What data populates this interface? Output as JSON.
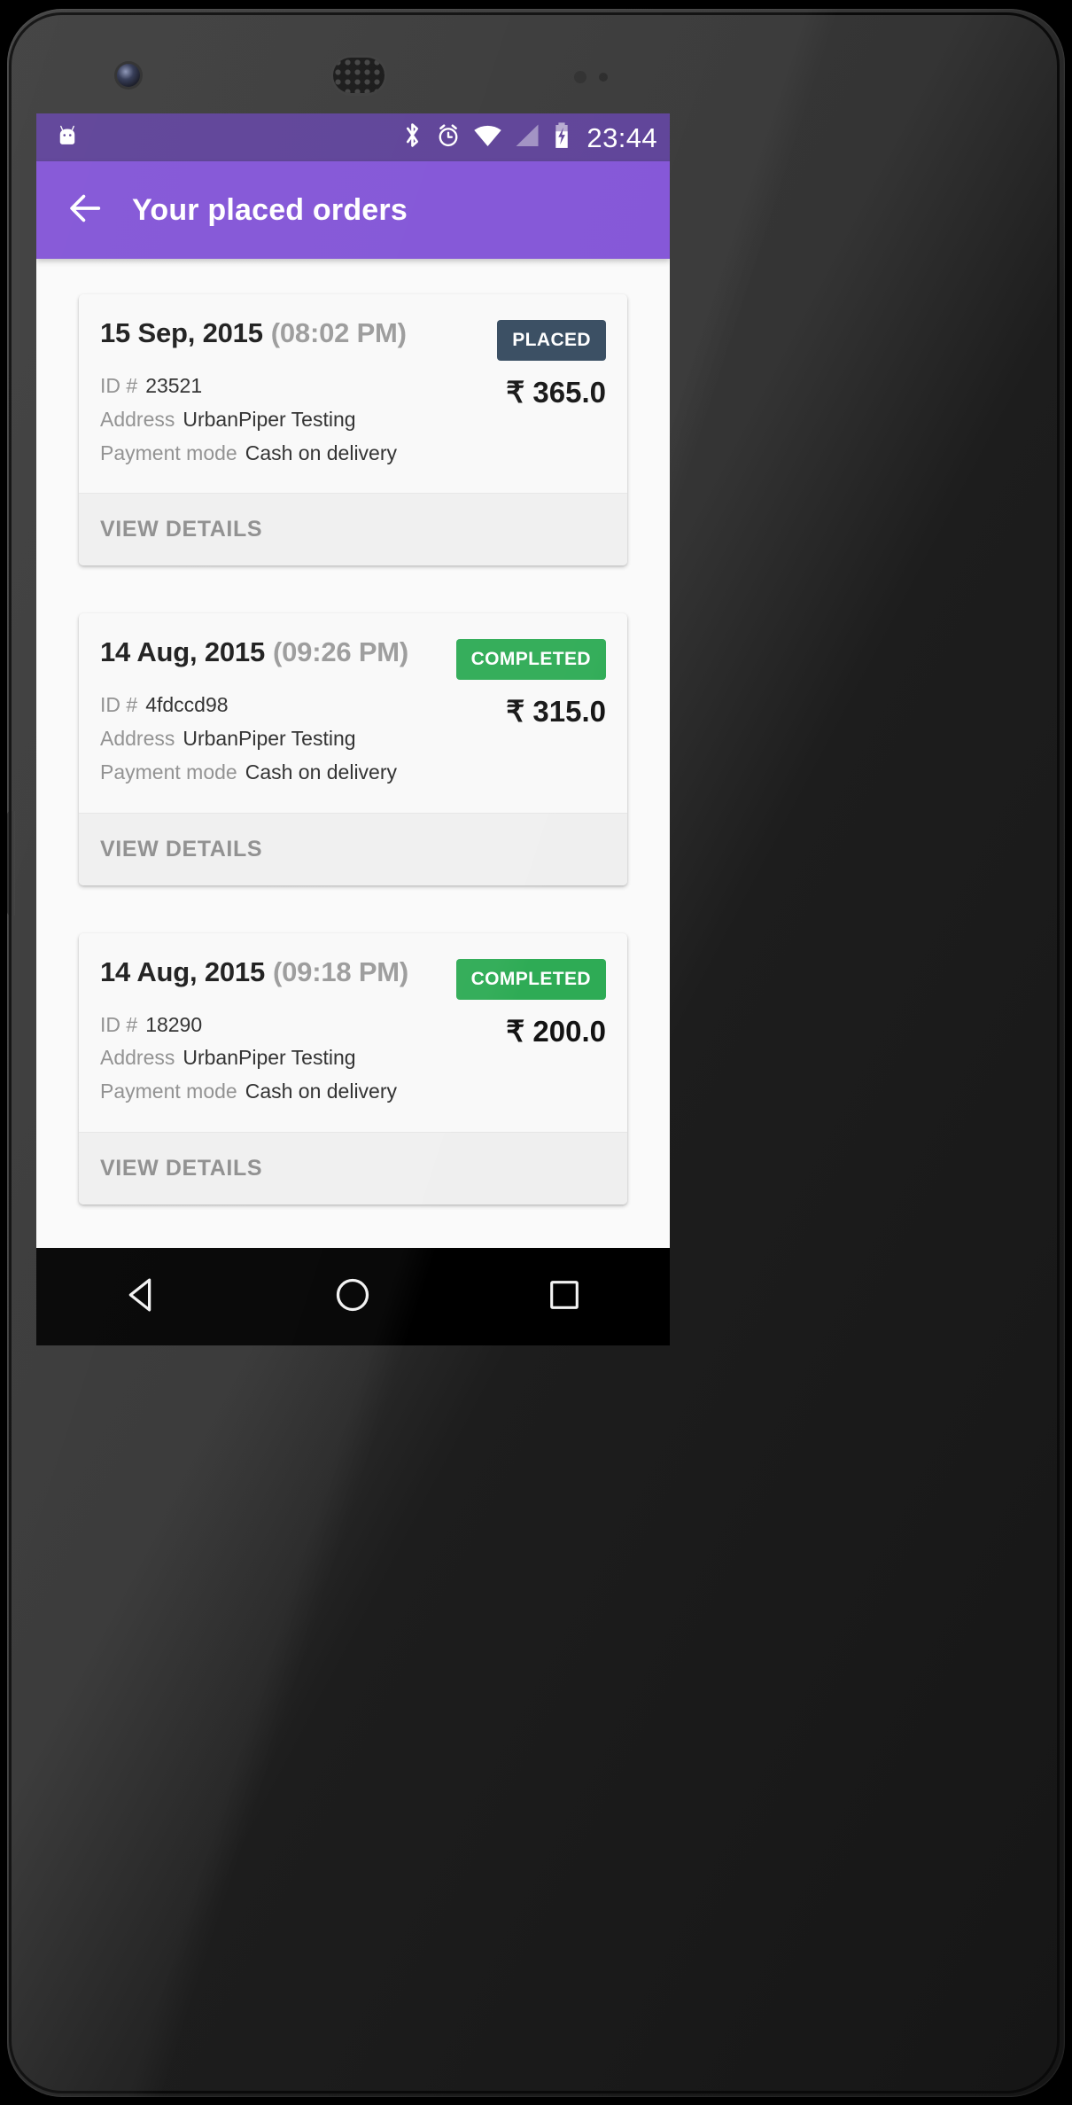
{
  "status_bar": {
    "android_icon": "android-head-icon",
    "icons": [
      "bluetooth-icon",
      "alarm-clock-icon",
      "wifi-icon",
      "cellular-signal-icon",
      "battery-charging-icon"
    ],
    "clock": "23:44",
    "background_color": "#5b3f96"
  },
  "app_bar": {
    "back_icon": "back-arrow-icon",
    "title": "Your placed orders",
    "background_color": "#8152d6"
  },
  "labels": {
    "id": "ID  #",
    "address": "Address",
    "payment_mode": "Payment mode",
    "view_details": "VIEW DETAILS"
  },
  "status_colors": {
    "PLACED": "#34495e",
    "COMPLETED": "#2eab55"
  },
  "orders": [
    {
      "date": "15 Sep, 2015",
      "time": "(08:02 PM)",
      "status": "PLACED",
      "id": "23521",
      "address": "UrbanPiper Testing",
      "payment_mode": "Cash on delivery",
      "total": "₹ 365.0"
    },
    {
      "date": "14 Aug, 2015",
      "time": "(09:26 PM)",
      "status": "COMPLETED",
      "id": "4fdccd98",
      "address": "UrbanPiper Testing",
      "payment_mode": "Cash on delivery",
      "total": "₹ 315.0"
    },
    {
      "date": "14 Aug, 2015",
      "time": "(09:18 PM)",
      "status": "COMPLETED",
      "id": "18290",
      "address": "UrbanPiper Testing",
      "payment_mode": "Cash on delivery",
      "total": "₹ 200.0"
    }
  ],
  "nav_bar": {
    "back": "nav-back-triangle-icon",
    "home": "nav-home-circle-icon",
    "recents": "nav-recents-square-icon"
  }
}
